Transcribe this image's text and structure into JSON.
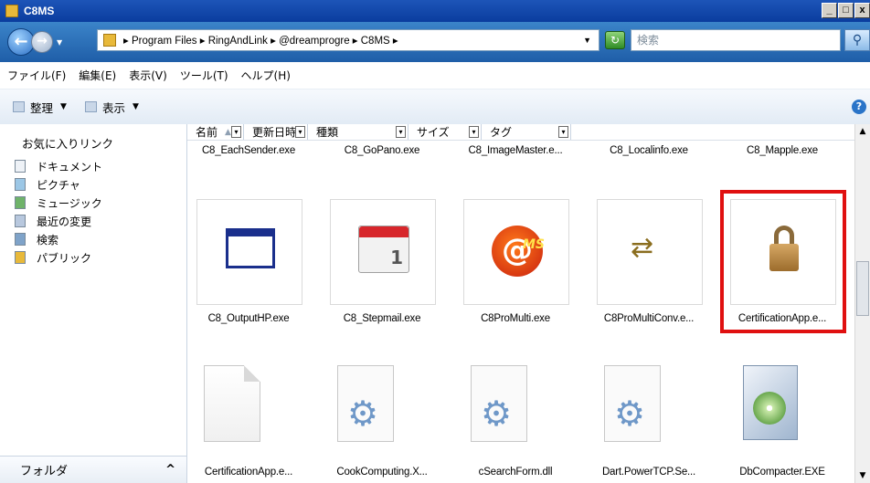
{
  "window": {
    "title": "C8MS",
    "buttons": [
      "_",
      "□",
      "x"
    ]
  },
  "address": {
    "path": "▸ Program Files ▸ RingAndLink ▸ @dreamprogre ▸ C8MS ▸",
    "search_placeholder": "検索"
  },
  "menu": [
    "ファイル(F)",
    "編集(E)",
    "表示(V)",
    "ツール(T)",
    "ヘルプ(H)"
  ],
  "toolbar": {
    "organize": "整理",
    "view": "表示"
  },
  "favorites": {
    "title": "お気に入りリンク",
    "items": [
      "ドキュメント",
      "ピクチャ",
      "ミュージック",
      "最近の変更",
      "検索",
      "パブリック"
    ],
    "folder_label": "フォルダ"
  },
  "columns": [
    "名前",
    "更新日時",
    "種類",
    "サイズ",
    "タグ"
  ],
  "files_row0": [
    "C8_EachSender.exe",
    "C8_GoPano.exe",
    "C8_ImageMaster.e...",
    "C8_Localinfo.exe",
    "C8_Mapple.exe"
  ],
  "files_row1": [
    "C8_OutputHP.exe",
    "C8_Stepmail.exe",
    "C8ProMulti.exe",
    "C8ProMultiConv.e...",
    "CertificationApp.e..."
  ],
  "files_row2": [
    "CertificationApp.e...",
    "CookComputing.X...",
    "cSearchForm.dll",
    "Dart.PowerTCP.Se...",
    "DbCompacter.EXE"
  ],
  "icons": {
    "calendar_day": "1",
    "pms_badge": "MS",
    "help": "?"
  },
  "colors": {
    "highlight": "#e01010",
    "title_bar": "#1d55b8"
  }
}
